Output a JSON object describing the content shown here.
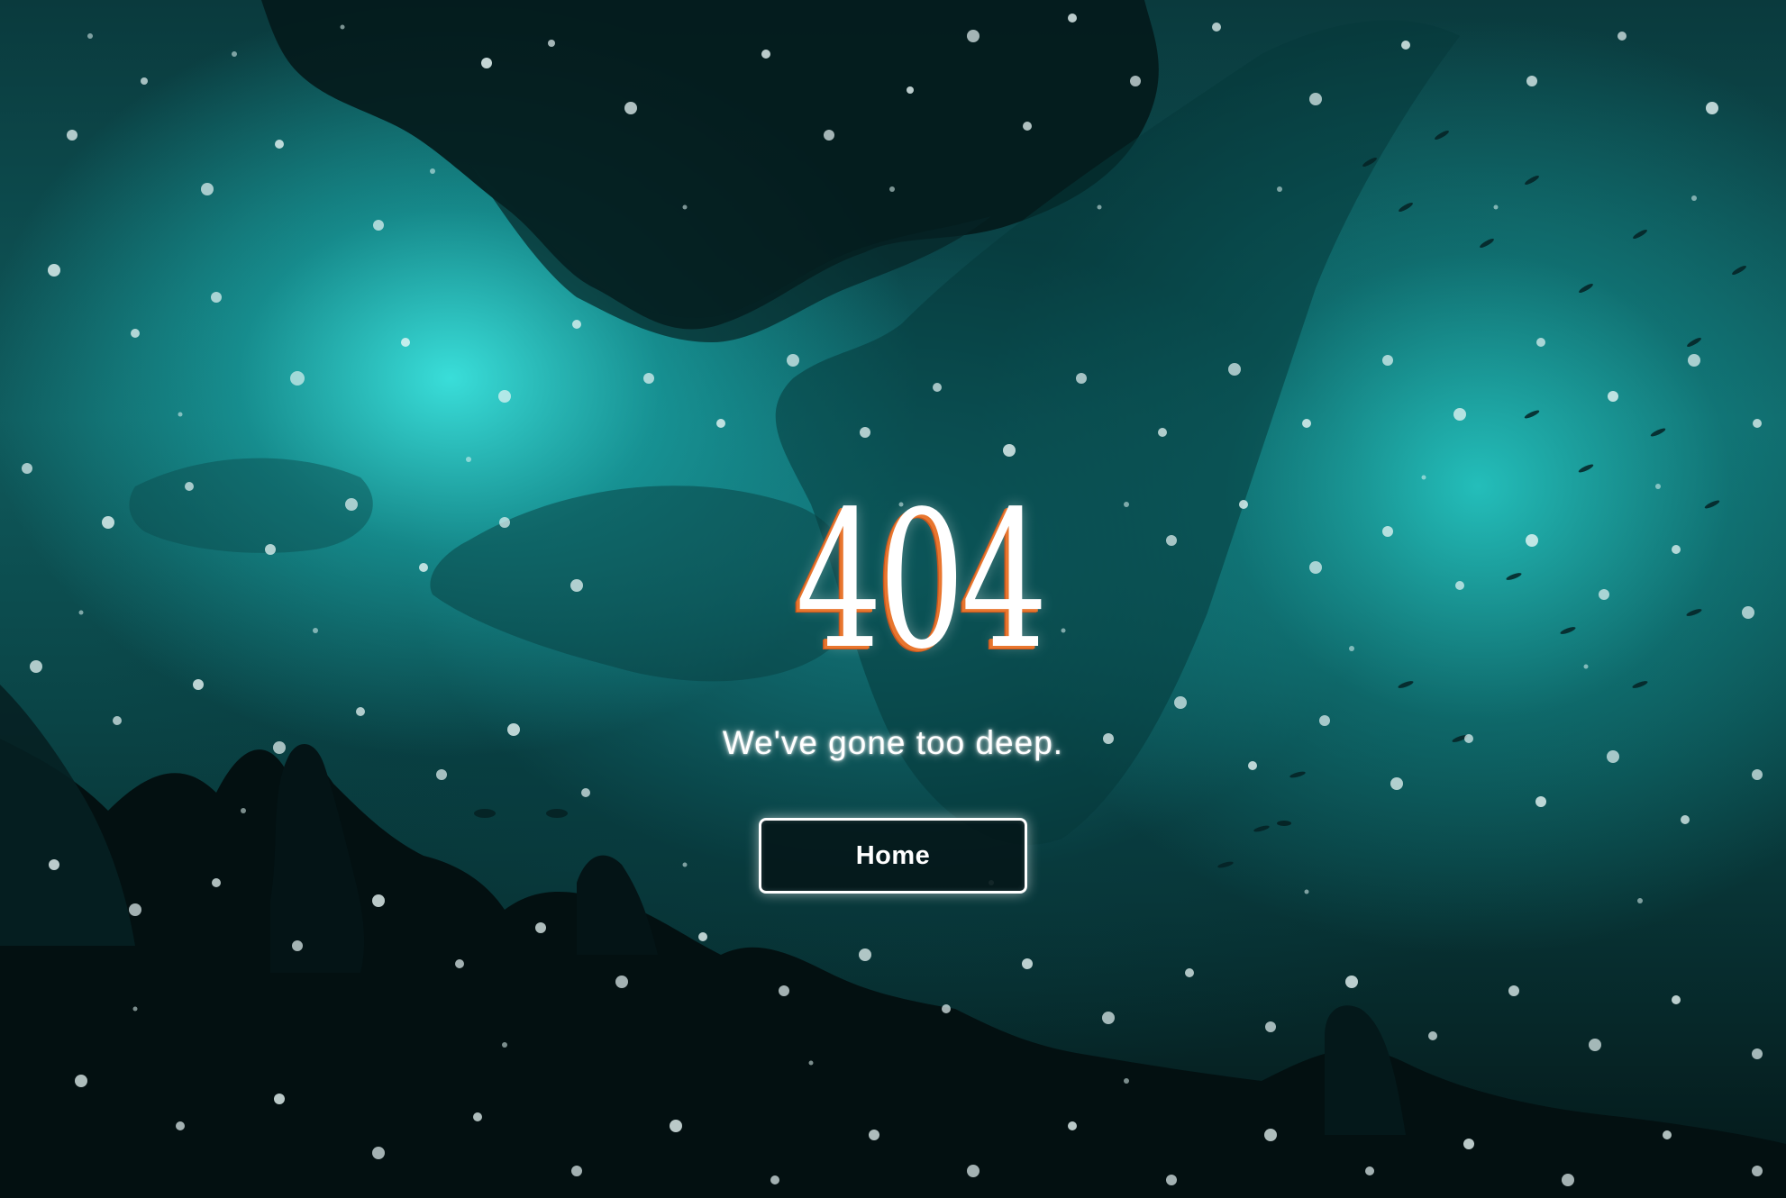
{
  "page": {
    "error_code": "404",
    "message": "We've gone too deep.",
    "home_button_label": "Home"
  },
  "colors": {
    "water_light": "#3ce6e1",
    "water_dark": "#041416",
    "code_shadow": "#e8762e",
    "text": "#ffffff"
  },
  "background": {
    "scene": "underwater-reef-with-fish-school",
    "overlay": "floating-bubbles"
  }
}
